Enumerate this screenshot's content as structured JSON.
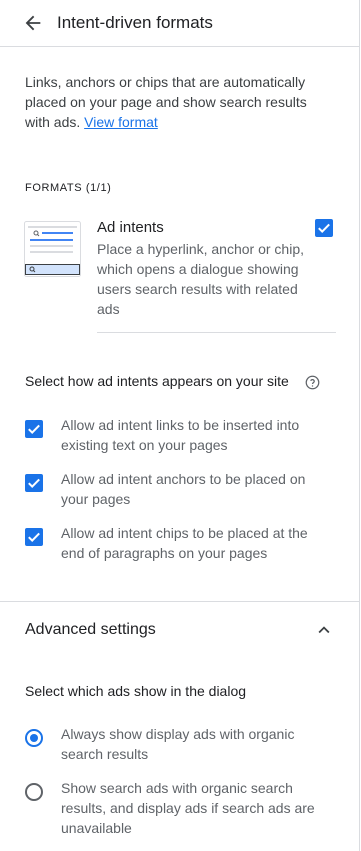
{
  "header": {
    "title": "Intent-driven formats",
    "back_icon": "arrow-back-icon"
  },
  "intro": {
    "text": "Links, anchors or chips that are automatically placed on your page and show search results with ads.",
    "link_label": "View format"
  },
  "formats": {
    "label": "FORMATS (1/1)",
    "items": [
      {
        "title": "Ad intents",
        "description": "Place a hyperlink, anchor or chip, which opens a dialogue showing users search results with related ads",
        "checked": true,
        "thumbnail_icon": "ad-intent-preview-icon"
      }
    ]
  },
  "appearance": {
    "heading": "Select how ad intents appears on your site",
    "help_icon": "help-circle-icon",
    "options": [
      {
        "label": "Allow ad intent links to be inserted into existing text on your pages",
        "checked": true
      },
      {
        "label": "Allow ad intent anchors to be placed on your pages",
        "checked": true
      },
      {
        "label": "Allow ad intent chips to be placed at the end of paragraphs on your pages",
        "checked": true
      }
    ]
  },
  "advanced": {
    "title": "Advanced settings",
    "expanded": true,
    "chevron_icon": "chevron-up-icon",
    "ads_heading": "Select which ads show in the dialog",
    "radio_options": [
      {
        "label": "Always show display ads with organic search results",
        "selected": true
      },
      {
        "label": "Show search ads with organic search results, and display ads if search ads are unavailable",
        "selected": false
      }
    ]
  },
  "colors": {
    "accent": "#1a73e8",
    "divider": "#dadce0",
    "text_primary": "#202124",
    "text_secondary": "#5f6368"
  }
}
